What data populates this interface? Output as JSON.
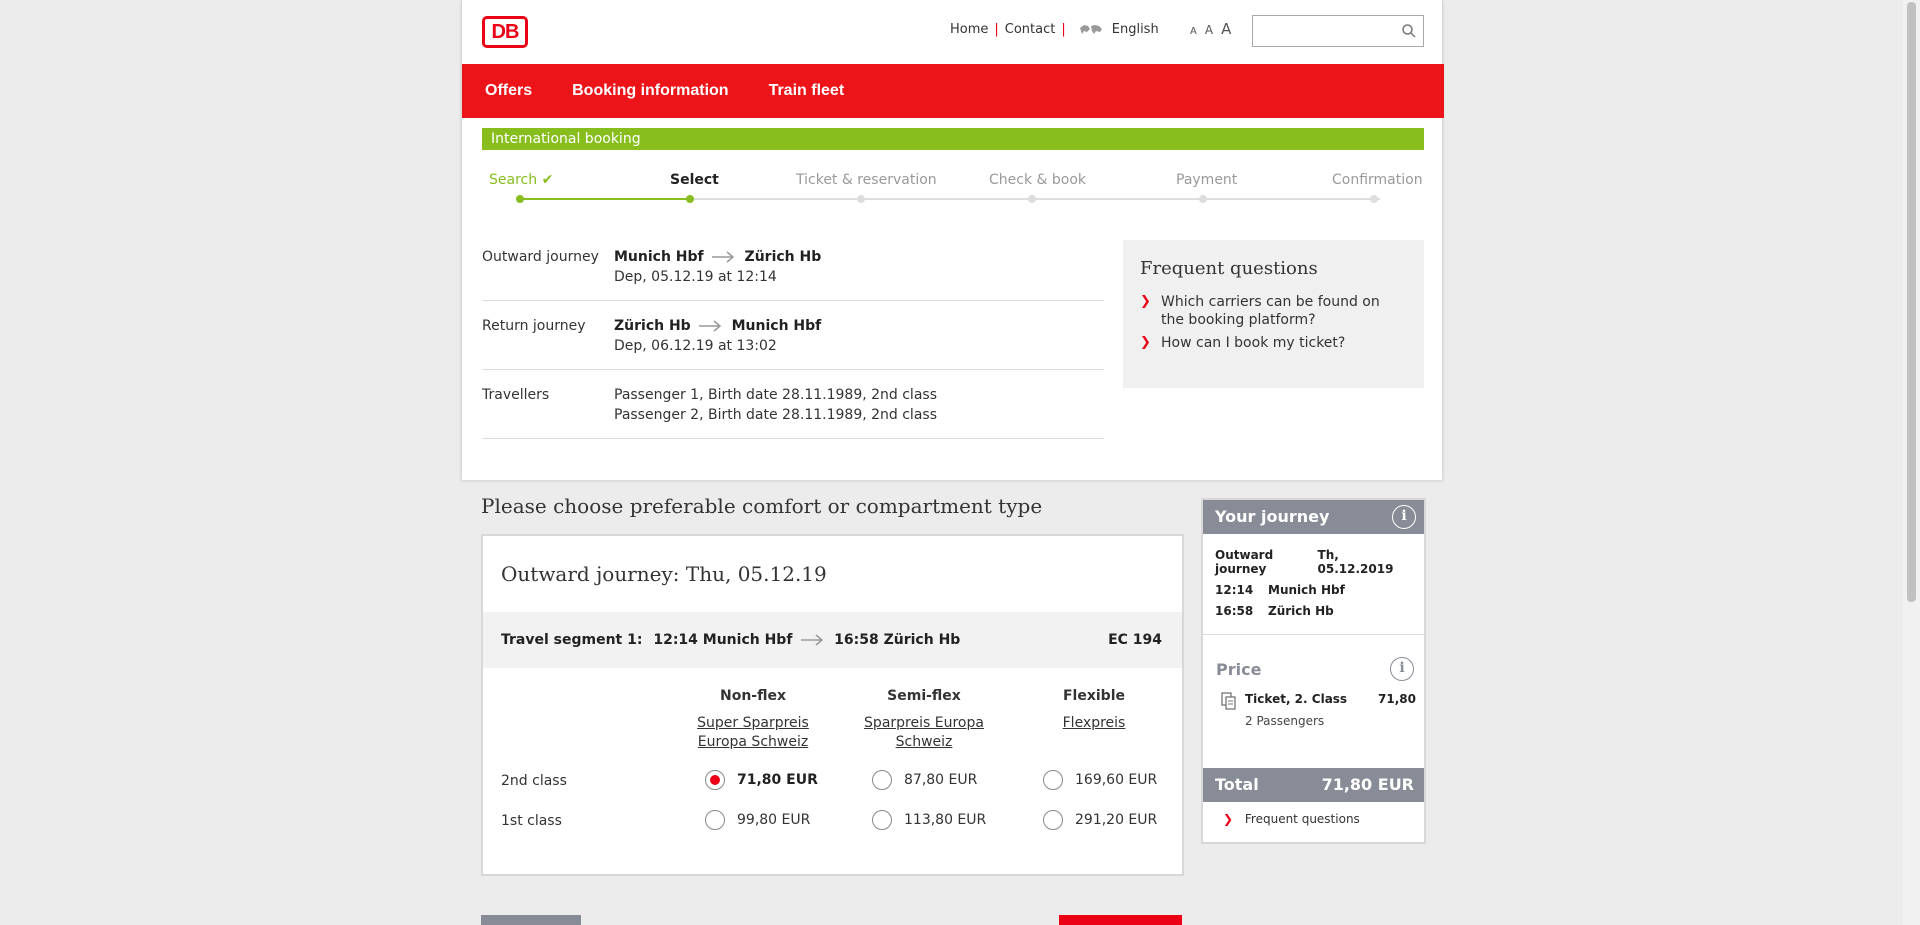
{
  "header": {
    "logo_text": "DB",
    "links": {
      "home": "Home",
      "sep1": "|",
      "contact": "Contact",
      "sep2": "|",
      "language": "English"
    },
    "font_sizes": [
      "A",
      "A",
      "A"
    ],
    "search": {
      "value": "",
      "placeholder": ""
    }
  },
  "nav": {
    "items": [
      "Offers",
      "Booking information",
      "Train fleet"
    ]
  },
  "banner": "International booking",
  "progress": {
    "steps": [
      {
        "label": "Search",
        "check": "✔"
      },
      {
        "label": "Select"
      },
      {
        "label": "Ticket & reservation"
      },
      {
        "label": "Check & book"
      },
      {
        "label": "Payment"
      },
      {
        "label": "Confirmation"
      }
    ],
    "completed_steps": 1,
    "current_step": 2
  },
  "summary": {
    "outward": {
      "label": "Outward journey",
      "from": "Munich Hbf",
      "to": "Zürich Hb",
      "dep": "Dep, 05.12.19 at 12:14"
    },
    "return": {
      "label": "Return journey",
      "from": "Zürich Hb",
      "to": "Munich Hbf",
      "dep": "Dep, 06.12.19 at 13:02"
    },
    "travellers": {
      "label": "Travellers",
      "p1": "Passenger 1, Birth date 28.11.1989, 2nd class",
      "p2": "Passenger 2, Birth date 28.11.1989, 2nd class"
    }
  },
  "faq": {
    "title": "Frequent questions",
    "chevron": "❯",
    "q1": "Which carriers can be found on the booking platform?",
    "q2": "How can I book my ticket?"
  },
  "choose": {
    "title": "Please choose preferable comfort or compartment type",
    "journey_title": "Outward journey: Thu, 05.12.19",
    "segment": {
      "prefix": "Travel segment 1:",
      "dep": "12:14 Munich Hbf",
      "arr": "16:58 Zürich Hb",
      "train": "EC 194"
    },
    "columns": [
      {
        "name": "Non-flex",
        "tariff_line1": "Super Sparpreis",
        "tariff_line2": "Europa Schweiz"
      },
      {
        "name": "Semi-flex",
        "tariff_line1": "Sparpreis Europa",
        "tariff_line2": "Schweiz"
      },
      {
        "name": "Flexible",
        "tariff_line1": "Flexpreis",
        "tariff_line2": ""
      }
    ],
    "rows": [
      {
        "label": "2nd class",
        "prices": [
          "71,80 EUR",
          "87,80 EUR",
          "169,60 EUR"
        ]
      },
      {
        "label": "1st class",
        "prices": [
          "99,80 EUR",
          "113,80 EUR",
          "291,20 EUR"
        ]
      }
    ],
    "selected": "2nd class / Non-flex"
  },
  "journey_card": {
    "title": "Your journey",
    "info": "i",
    "outward_label": "Outward journey",
    "outward_date": "Th, 05.12.2019",
    "dep_time": "12:14",
    "dep_station": "Munich Hbf",
    "arr_time": "16:58",
    "arr_station": "Zürich Hb",
    "price_title": "Price",
    "ticket_label": "Ticket, 2. Class",
    "ticket_price": "71,80",
    "passengers": "2 Passengers",
    "total_label": "Total",
    "total_value": "71,80 EUR",
    "faq_chevron": "❯",
    "faq_link": "Frequent questions"
  },
  "colors": {
    "db_red": "#ec0016",
    "nav_red": "#ec1419",
    "green": "#87be1e",
    "grey_header": "#878c96"
  }
}
